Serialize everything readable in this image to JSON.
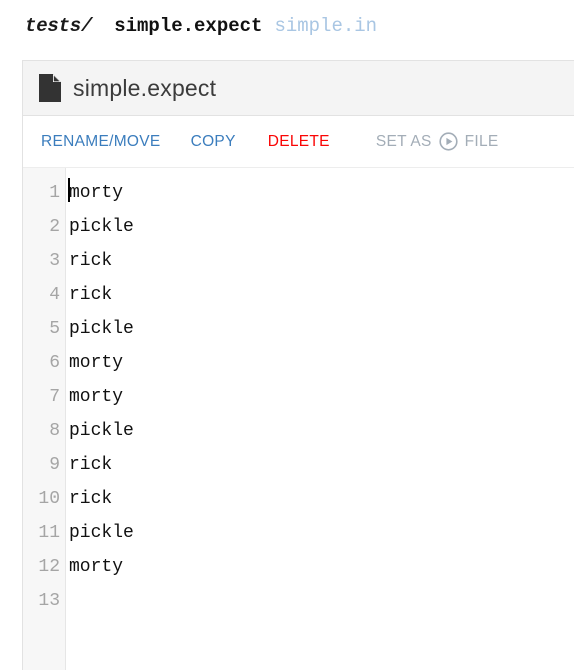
{
  "breadcrumb": {
    "directory": "tests/",
    "active_file": "simple.expect",
    "other_file": "simple.in"
  },
  "card": {
    "icon": "file-icon",
    "title": "simple.expect",
    "toolbar": {
      "rename_move": "RENAME/MOVE",
      "copy": "COPY",
      "delete": "DELETE",
      "set_as_prefix": "SET AS",
      "run_icon": "play-circle-icon",
      "set_as_suffix": "FILE"
    }
  },
  "editor": {
    "line_numbers": [
      "1",
      "2",
      "3",
      "4",
      "5",
      "6",
      "7",
      "8",
      "9",
      "10",
      "11",
      "12",
      "13"
    ],
    "lines": [
      "morty",
      "pickle",
      "rick",
      "rick",
      "pickle",
      "morty",
      "morty",
      "pickle",
      "rick",
      "rick",
      "pickle",
      "morty",
      ""
    ]
  },
  "colors": {
    "link_blue": "#3b7dbd",
    "danger_red": "#fa0505",
    "muted_gray": "#a3adb7",
    "inactive_tab_blue": "#a9c6e3",
    "gutter_bg": "#f7f7f7",
    "header_bg": "#f4f4f4"
  }
}
